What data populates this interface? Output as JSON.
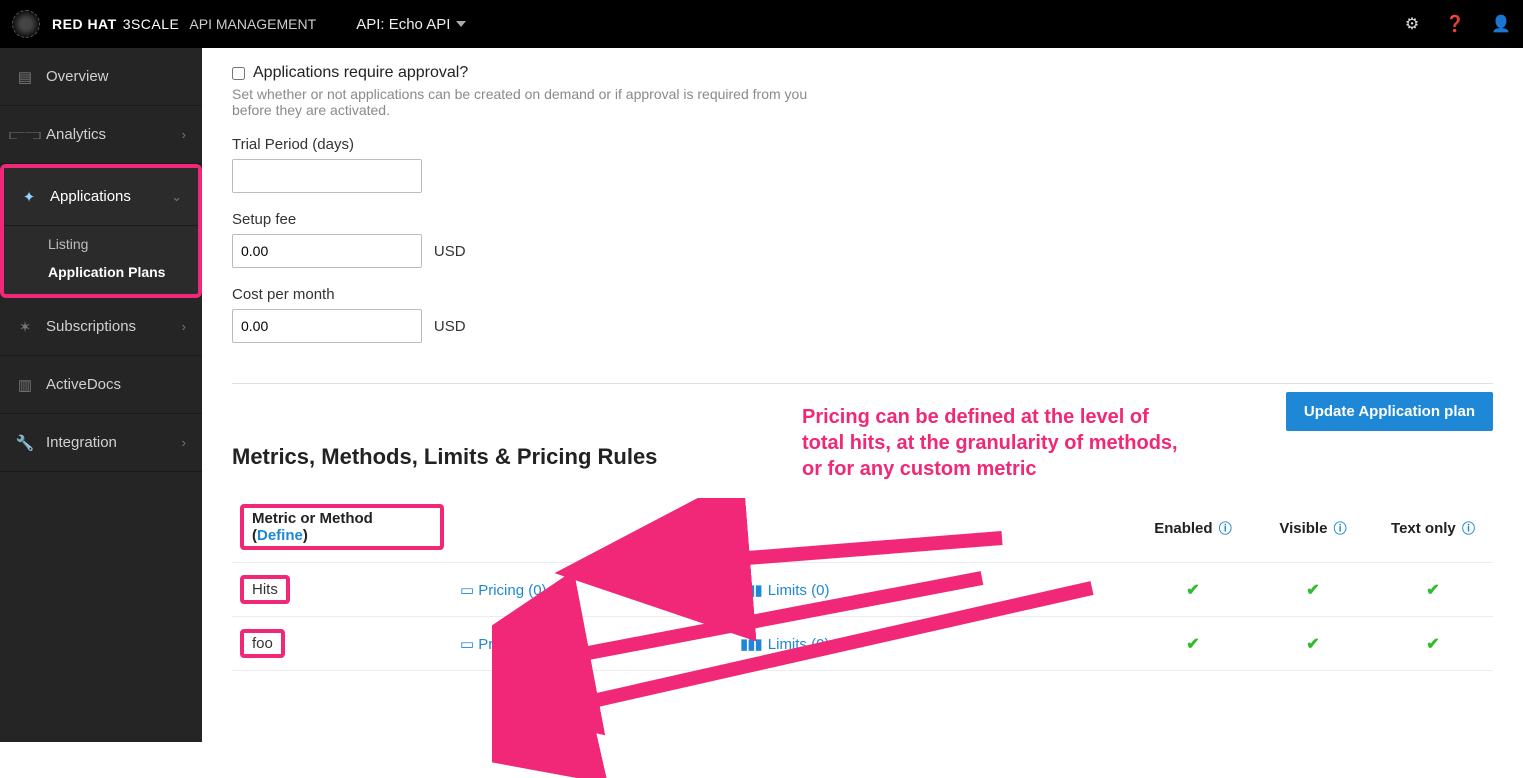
{
  "header": {
    "brand1": "RED HAT",
    "brand2": "3SCALE",
    "product": "API MANAGEMENT",
    "api_selector": "API: Echo API"
  },
  "sidebar": {
    "items": [
      {
        "label": "Overview",
        "expandable": false
      },
      {
        "label": "Analytics",
        "expandable": true
      },
      {
        "label": "Applications",
        "expandable": true,
        "children": [
          {
            "label": "Listing",
            "active": false
          },
          {
            "label": "Application Plans",
            "active": true
          }
        ]
      },
      {
        "label": "Subscriptions",
        "expandable": true
      },
      {
        "label": "ActiveDocs",
        "expandable": false
      },
      {
        "label": "Integration",
        "expandable": true
      }
    ]
  },
  "form": {
    "approval_label": "Applications require approval?",
    "approval_help": "Set whether or not applications can be created on demand or if approval is required from you before they are activated.",
    "trial_label": "Trial Period (days)",
    "trial_value": "",
    "setup_label": "Setup fee",
    "setup_value": "0.00",
    "setup_unit": "USD",
    "cost_label": "Cost per month",
    "cost_value": "0.00",
    "cost_unit": "USD",
    "update_btn": "Update Application plan"
  },
  "section_title": "Metrics, Methods, Limits & Pricing Rules",
  "table": {
    "col_metric": "Metric or Method (",
    "col_define": "Define",
    "col_metric_close": ")",
    "col_enabled": "Enabled",
    "col_visible": "Visible",
    "col_textonly": "Text only",
    "rows": [
      {
        "name": "Hits",
        "pricing": "Pricing (0)",
        "limits": "Limits (0)"
      },
      {
        "name": "foo",
        "pricing": "Pricing (0)",
        "limits": "Limits (0)"
      }
    ]
  },
  "annotation": {
    "text": "Pricing can be defined at the level of total hits, at the granularity of methods, or for any custom metric"
  }
}
